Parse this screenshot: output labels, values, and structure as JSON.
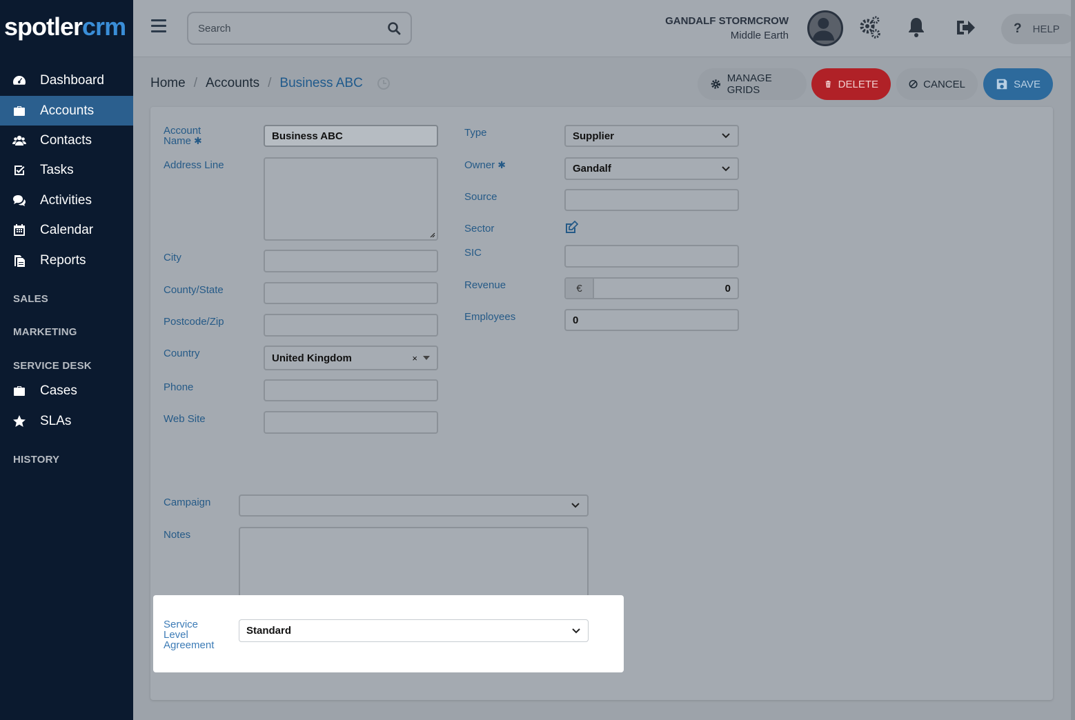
{
  "logo": {
    "part1": "spotler",
    "part2": "crm"
  },
  "sidebar": {
    "items": [
      {
        "label": "Dashboard",
        "icon": "dashboard-icon"
      },
      {
        "label": "Accounts",
        "icon": "briefcase-icon",
        "active": true
      },
      {
        "label": "Contacts",
        "icon": "users-icon"
      },
      {
        "label": "Tasks",
        "icon": "checkbox-icon"
      },
      {
        "label": "Activities",
        "icon": "comments-icon"
      },
      {
        "label": "Calendar",
        "icon": "calendar-icon"
      },
      {
        "label": "Reports",
        "icon": "reports-icon"
      }
    ],
    "sections": {
      "sales": "SALES",
      "marketing": "MARKETING",
      "service_desk": "SERVICE DESK",
      "history": "HISTORY"
    },
    "service_items": [
      {
        "label": "Cases",
        "icon": "briefcase-icon"
      },
      {
        "label": "SLAs",
        "icon": "star-icon"
      }
    ]
  },
  "topbar": {
    "search_placeholder": "Search",
    "user_name": "GANDALF STORMCROW",
    "user_org": "Middle Earth",
    "help_label": "HELP"
  },
  "breadcrumb": {
    "home": "Home",
    "accounts": "Accounts",
    "current": "Business ABC"
  },
  "actions": {
    "manage_grids": "MANAGE GRIDS",
    "delete": "DELETE",
    "cancel": "CANCEL",
    "save": "SAVE"
  },
  "form": {
    "left": {
      "account_name_label_1": "Account",
      "account_name_label_2": "Name",
      "account_name_value": "Business ABC",
      "address_label": "Address Line",
      "city_label": "City",
      "county_label": "County/State",
      "postcode_label": "Postcode/Zip",
      "country_label": "Country",
      "country_value": "United Kingdom",
      "phone_label": "Phone",
      "website_label": "Web Site"
    },
    "right": {
      "type_label": "Type",
      "type_value": "Supplier",
      "owner_label": "Owner",
      "owner_value": "Gandalf",
      "source_label": "Source",
      "sector_label": "Sector",
      "sic_label": "SIC",
      "revenue_label": "Revenue",
      "revenue_currency": "€",
      "revenue_value": "0",
      "employees_label": "Employees",
      "employees_value": "0"
    },
    "campaign_label": "Campaign",
    "notes_label": "Notes",
    "sla_label_1": "Service",
    "sla_label_2": "Level",
    "sla_label_3": "Agreement",
    "sla_value": "Standard",
    "required_mark": "✱"
  },
  "colors": {
    "sidebar_bg": "#0b1a2f",
    "active_nav": "#2b5f8e",
    "delete": "#b02127",
    "save": "#2d6a9c",
    "link": "#1f5a8c"
  }
}
